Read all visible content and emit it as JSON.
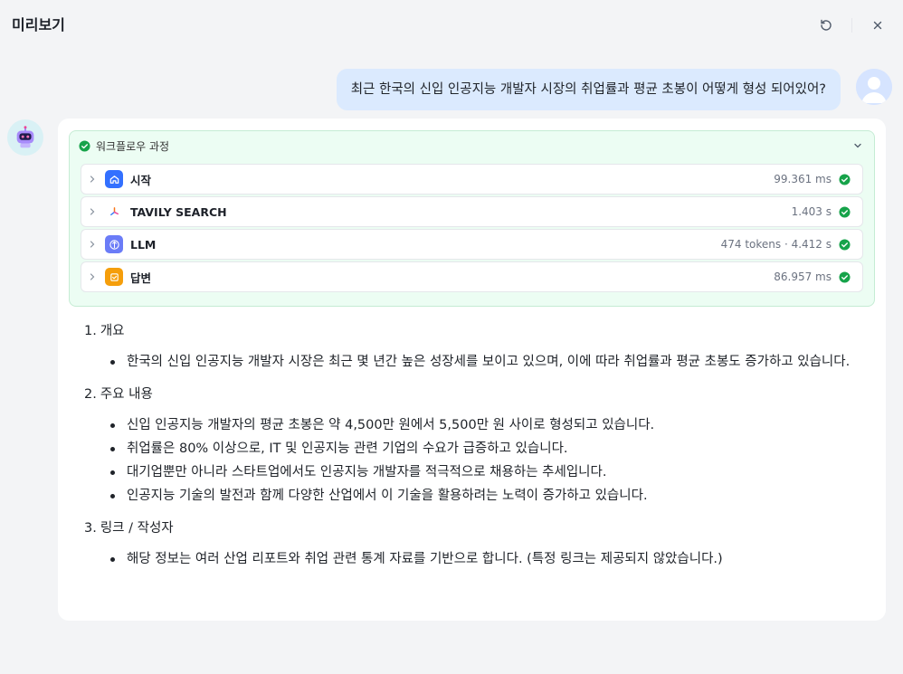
{
  "window": {
    "title": "미리보기"
  },
  "user_message": "최근 한국의 신입 인공지능 개발자 시장의 취업률과 평균 초봉이 어떻게 형성 되어있어?",
  "workflow": {
    "title": "워크플로우 과정",
    "steps": [
      {
        "label": "시작",
        "meta": "99.361 ms",
        "icon": "home-icon",
        "color": "#3370ff"
      },
      {
        "label": "TAVILY SEARCH",
        "meta": "1.403 s",
        "icon": "tavily-icon",
        "color": "#ffffff"
      },
      {
        "label": "LLM",
        "meta": "474 tokens · 4.412 s",
        "icon": "llm-icon",
        "color": "#6b7cf7"
      },
      {
        "label": "답변",
        "meta": "86.957 ms",
        "icon": "answer-icon",
        "color": "#f59e0b"
      }
    ]
  },
  "answer": {
    "sections": [
      {
        "num": "1.",
        "title": "개요",
        "bullets": [
          "한국의 신입 인공지능 개발자 시장은 최근 몇 년간 높은 성장세를 보이고 있으며, 이에 따라 취업률과 평균 초봉도 증가하고 있습니다."
        ]
      },
      {
        "num": "2.",
        "title": "주요 내용",
        "bullets": [
          "신입 인공지능 개발자의 평균 초봉은 약 4,500만 원에서 5,500만 원 사이로 형성되고 있습니다.",
          "취업률은 80% 이상으로, IT 및 인공지능 관련 기업의 수요가 급증하고 있습니다.",
          "대기업뿐만 아니라 스타트업에서도 인공지능 개발자를 적극적으로 채용하는 추세입니다.",
          "인공지능 기술의 발전과 함께 다양한 산업에서 이 기술을 활용하려는 노력이 증가하고 있습니다."
        ]
      },
      {
        "num": "3.",
        "title": "링크 / 작성자",
        "bullets": [
          "해당 정보는 여러 산업 리포트와 취업 관련 통계 자료를 기반으로 합니다. (특정 링크는 제공되지 않았습니다.)"
        ]
      }
    ]
  },
  "colors": {
    "success": "#16a34a",
    "user_bubble": "#dbeafe",
    "workflow_bg": "#ecfdf3"
  }
}
